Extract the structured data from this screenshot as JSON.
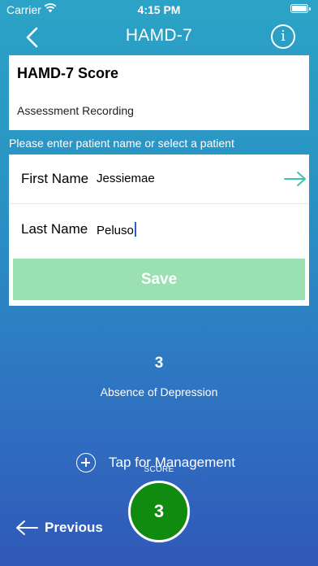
{
  "status_bar": {
    "carrier": "Carrier",
    "time": "4:15 PM"
  },
  "nav": {
    "title": "HAMD-7",
    "back_icon": "chevron-left-icon",
    "info_icon": "info-icon",
    "info_glyph": "i"
  },
  "score_card": {
    "title": "HAMD-7 Score",
    "subtitle": "Assessment Recording"
  },
  "prompt": "Please enter patient name or select a patient",
  "form": {
    "first_name_label": "First Name",
    "first_name_value": "Jessiemae",
    "last_name_label": "Last Name",
    "last_name_value": "Peluso",
    "save_label": "Save"
  },
  "result": {
    "score": "3",
    "severity": "Absence of Depression"
  },
  "management_label": "Tap for Management",
  "score_caption": "SCORE",
  "score_circle_value": "3",
  "previous_label": "Previous",
  "colors": {
    "background_top": "#2ba3c6",
    "background_bottom": "#3058b9",
    "save_button": "#9ae0b2",
    "arrow_accent": "#3cc7a8",
    "score_circle": "#118a10"
  }
}
